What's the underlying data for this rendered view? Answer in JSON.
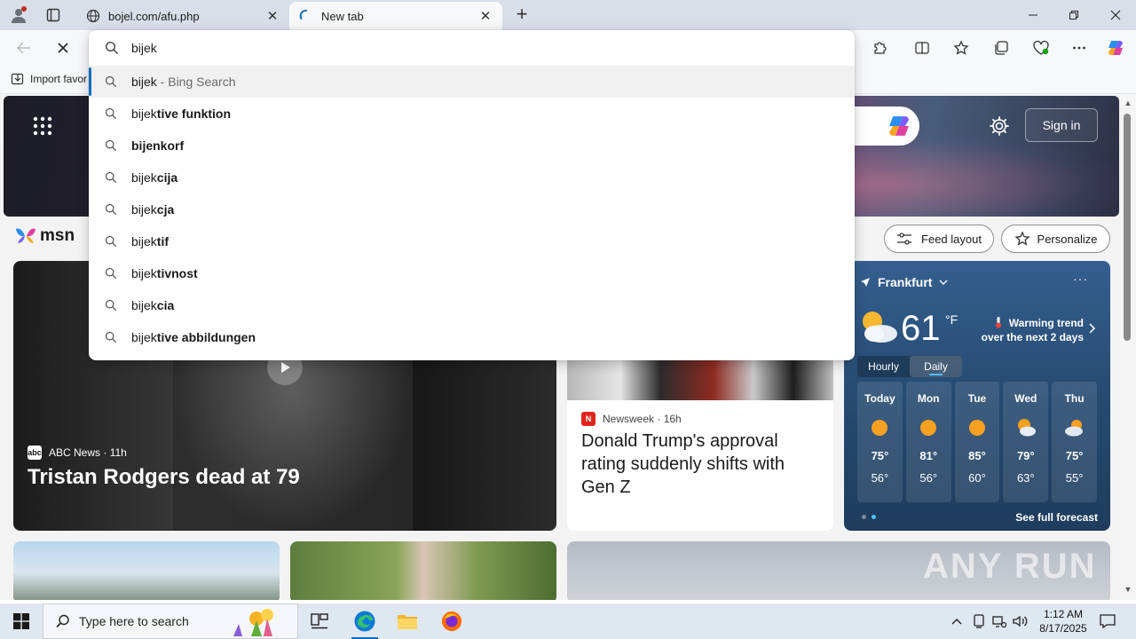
{
  "browser": {
    "tabs": [
      {
        "label": "bojel.com/afu.php",
        "active": false
      },
      {
        "label": "New tab",
        "active": true
      }
    ],
    "favorites": {
      "import_label": "Import favor"
    }
  },
  "omnibox": {
    "query": "bijek",
    "suggestions": [
      {
        "typed": "bijek",
        "completion": "",
        "hint": " - Bing Search",
        "selected": true
      },
      {
        "typed": "bijek",
        "completion": "tive funktion",
        "hint": ""
      },
      {
        "typed": "",
        "completion": "bijenkorf",
        "hint": ""
      },
      {
        "typed": "bijek",
        "completion": "cija",
        "hint": ""
      },
      {
        "typed": "bijek",
        "completion": "cja",
        "hint": ""
      },
      {
        "typed": "bijek",
        "completion": "tif",
        "hint": ""
      },
      {
        "typed": "bijek",
        "completion": "tivnost",
        "hint": ""
      },
      {
        "typed": "bijek",
        "completion": "cia",
        "hint": ""
      },
      {
        "typed": "bijek",
        "completion": "tive abbildungen",
        "hint": ""
      }
    ]
  },
  "msn": {
    "logo": "msn",
    "signin_label": "Sign in",
    "feed_layout_label": "Feed layout",
    "personalize_label": "Personalize",
    "main_card": {
      "source": "ABC News",
      "age": "11h",
      "title": "Tristan Rodgers dead at 79"
    },
    "news_card": {
      "source": "Newsweek",
      "age": "16h",
      "title": "Donald Trump's approval rating suddenly shifts with Gen Z"
    },
    "weather": {
      "location": "Frankfurt",
      "temp": "61",
      "unit": "°F",
      "trend_line1": "Warming trend",
      "trend_line2": "over the next 2 days",
      "tabs": [
        "Hourly",
        "Daily"
      ],
      "active_tab": "Daily",
      "days": [
        {
          "name": "Today",
          "hi": "75°",
          "lo": "56°",
          "icon": "sun-icon"
        },
        {
          "name": "Mon",
          "hi": "81°",
          "lo": "56°",
          "icon": "sun-icon"
        },
        {
          "name": "Tue",
          "hi": "85°",
          "lo": "60°",
          "icon": "sun-icon"
        },
        {
          "name": "Wed",
          "hi": "79°",
          "lo": "63°",
          "icon": "partly-cloudy-icon"
        },
        {
          "name": "Thu",
          "hi": "75°",
          "lo": "55°",
          "icon": "partly-cloudy-icon"
        }
      ],
      "full_forecast_label": "See full forecast"
    },
    "watermark": "ANY RUN"
  },
  "taskbar": {
    "search_placeholder": "Type here to search",
    "time": "1:12 AM",
    "date": "8/17/2025"
  },
  "colors": {
    "accent": "#0f6cbd",
    "tabstrip": "#d8dfe8",
    "weather_bg": "#2b5180"
  }
}
